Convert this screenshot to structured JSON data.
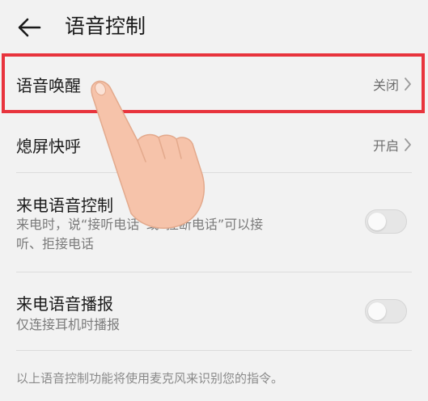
{
  "header": {
    "title": "语音控制",
    "back_icon": "arrow-left-icon"
  },
  "settings": {
    "voice_wakeup": {
      "label": "语音唤醒",
      "value": "关闭"
    },
    "screen_off_call": {
      "label": "熄屏快呼",
      "value": "开启"
    },
    "incoming_call_control": {
      "label": "来电语音控制",
      "description_line1": "来电时，说“接听电话”或“挂断电话”可以接",
      "description_line2": "听、拒接电话",
      "enabled": false
    },
    "incoming_call_announce": {
      "label": "来电语音播报",
      "description": "仅连接耳机时播报",
      "enabled": false
    }
  },
  "footer": {
    "note": "以上语音控制功能将使用麦克风来识别您的指令。"
  },
  "colors": {
    "highlight": "#e8343d",
    "background": "#f2f2f2",
    "hand": "#f6c3aa"
  }
}
